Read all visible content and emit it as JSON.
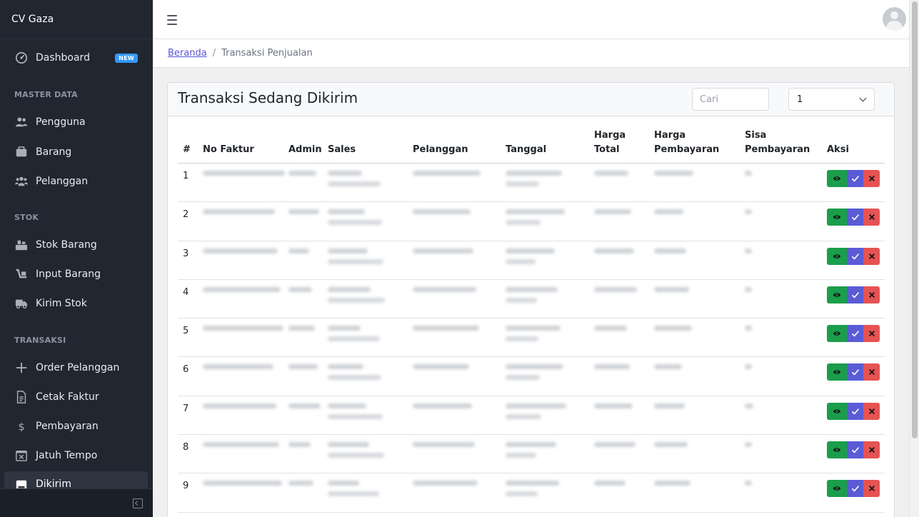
{
  "app": {
    "brand": "CV Gaza"
  },
  "sidebar": {
    "dashboard": {
      "label": "Dashboard",
      "badge": "NEW"
    },
    "sections": [
      {
        "title": "MASTER DATA",
        "items": [
          {
            "label": "Pengguna",
            "icon": "users-icon"
          },
          {
            "label": "Barang",
            "icon": "box-icon"
          },
          {
            "label": "Pelanggan",
            "icon": "customers-icon"
          }
        ]
      },
      {
        "title": "STOK",
        "items": [
          {
            "label": "Stok Barang",
            "icon": "stock-icon"
          },
          {
            "label": "Input Barang",
            "icon": "input-icon"
          },
          {
            "label": "Kirim Stok",
            "icon": "truck-icon"
          }
        ]
      },
      {
        "title": "TRANSAKSI",
        "items": [
          {
            "label": "Order Pelanggan",
            "icon": "plus-icon"
          },
          {
            "label": "Cetak Faktur",
            "icon": "invoice-icon"
          },
          {
            "label": "Pembayaran",
            "icon": "dollar-icon"
          },
          {
            "label": "Jatuh Tempo",
            "icon": "calendar-x-icon"
          },
          {
            "label": "Dikirim",
            "icon": "shipped-icon"
          }
        ]
      }
    ]
  },
  "breadcrumb": {
    "home": "Beranda",
    "separator": "/",
    "current": "Transaksi Penjualan"
  },
  "card": {
    "title": "Transaksi Sedang Dikirim",
    "search_placeholder": "Cari",
    "page_select_value": "1"
  },
  "table": {
    "headers": {
      "num": "#",
      "invoice": "No Faktur",
      "admin": "Admin",
      "sales": "Sales",
      "customer": "Pelanggan",
      "date": "Tanggal",
      "total_l1": "Harga",
      "total_l2": "Total",
      "paid_l1": "Harga",
      "paid_l2": "Pembayaran",
      "rest_l1": "Sisa",
      "rest_l2": "Pembayaran",
      "actions": "Aksi"
    },
    "rows": [
      "1",
      "2",
      "3",
      "4",
      "5",
      "6",
      "7",
      "8",
      "9"
    ]
  },
  "colors": {
    "view": "#1b9e4b",
    "confirm": "#5b5bd6",
    "delete": "#e55353",
    "sidebar": "#212631",
    "link": "#5856d6"
  }
}
